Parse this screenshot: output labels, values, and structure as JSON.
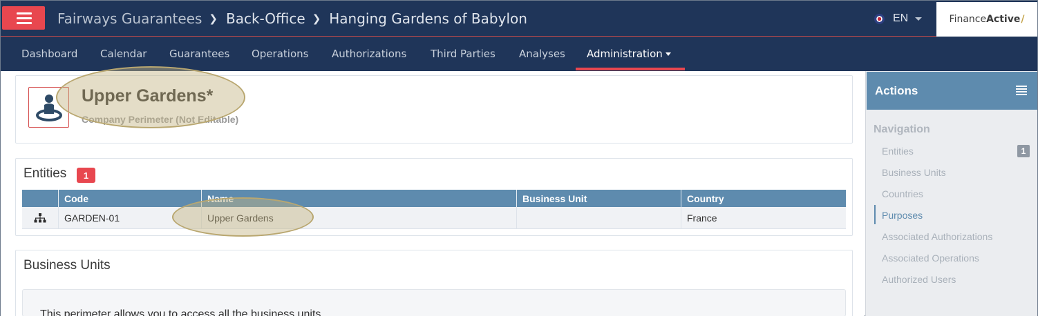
{
  "header": {
    "breadcrumbs": [
      "Fairways Guarantees",
      "Back-Office",
      "Hanging Gardens of Babylon"
    ],
    "language": "EN",
    "brand": {
      "part1": "Finance",
      "part2": "Active",
      "mark": "/"
    }
  },
  "nav": {
    "items": [
      "Dashboard",
      "Calendar",
      "Guarantees",
      "Operations",
      "Authorizations",
      "Third Parties",
      "Analyses",
      "Administration"
    ],
    "active": "Administration"
  },
  "perimeter": {
    "title": "Upper Gardens*",
    "subtitle": "Company Perimeter (Not Editable)"
  },
  "entities": {
    "title": "Entities",
    "count": "1",
    "columns": [
      "Code",
      "Name",
      "Business Unit",
      "Country"
    ],
    "rows": [
      {
        "code": "GARDEN-01",
        "name": "Upper Gardens",
        "business_unit": "",
        "country": "France"
      }
    ]
  },
  "business_units": {
    "title": "Business Units",
    "info": "This perimeter allows you to access all the business units."
  },
  "sidebar": {
    "title": "Actions",
    "section": "Navigation",
    "items": [
      {
        "label": "Entities",
        "badge": "1"
      },
      {
        "label": "Business Units"
      },
      {
        "label": "Countries"
      },
      {
        "label": "Purposes"
      },
      {
        "label": "Associated Authorizations"
      },
      {
        "label": "Associated Operations"
      },
      {
        "label": "Authorized Users"
      }
    ],
    "active": "Purposes"
  },
  "colors": {
    "header_bg": "#1f3559",
    "accent_red": "#e8474f",
    "table_header": "#5e8bae",
    "highlight": "#c4b482"
  }
}
